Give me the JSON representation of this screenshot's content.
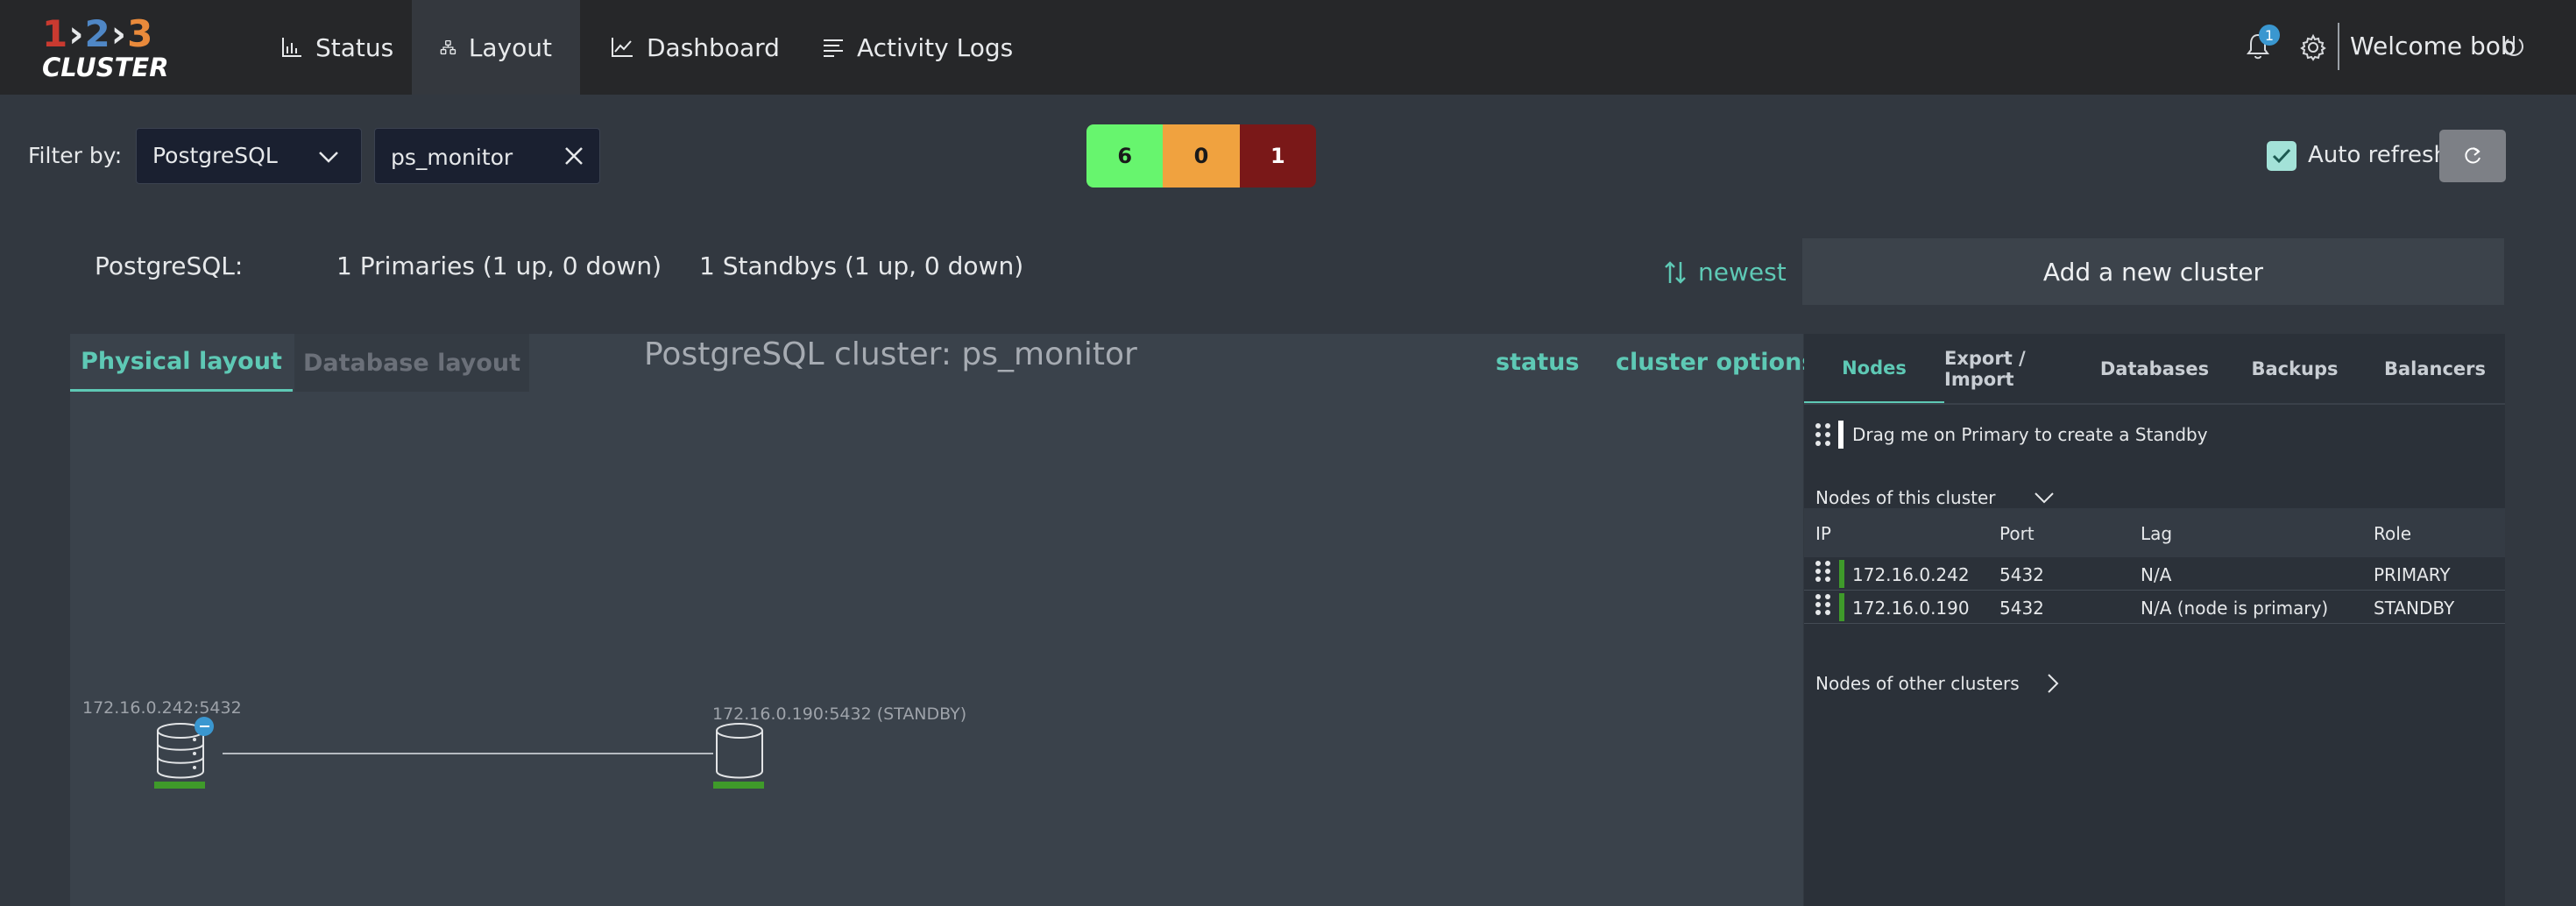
{
  "logo": {
    "n1": "1",
    "n2": "2",
    "n3": "3",
    "word": "CLUSTER"
  },
  "nav": {
    "items": [
      {
        "label": "Status",
        "icon": "bar-chart-icon"
      },
      {
        "label": "Layout",
        "icon": "topology-icon"
      },
      {
        "label": "Dashboard",
        "icon": "line-chart-icon"
      },
      {
        "label": "Activity Logs",
        "icon": "list-icon"
      }
    ],
    "active": "Layout"
  },
  "header": {
    "notification_count": "1",
    "welcome": "Welcome bob"
  },
  "filter": {
    "label": "Filter by:",
    "db_type": "PostgreSQL",
    "search_value": "ps_monitor"
  },
  "counts": {
    "up": "6",
    "warn": "0",
    "down": "1"
  },
  "auto_refresh": {
    "label": "Auto refresh",
    "checked": true
  },
  "summary": {
    "label": "PostgreSQL:",
    "primaries": "1 Primaries (1 up, 0 down)",
    "standbys": "1 Standbys (1 up, 0 down)",
    "sort": "newest"
  },
  "add_cluster": "Add a new cluster",
  "layout": {
    "tabs": [
      "Physical layout",
      "Database layout"
    ],
    "active_tab": "Physical layout",
    "cluster_title": "PostgreSQL cluster: ps_monitor",
    "links": {
      "status": "status",
      "options": "cluster options"
    },
    "nodes": [
      {
        "label": "172.16.0.242:5432"
      },
      {
        "label": "172.16.0.190:5432 (STANDBY)"
      }
    ]
  },
  "right_panel": {
    "tabs": [
      "Nodes",
      "Export / Import",
      "Databases",
      "Backups",
      "Balancers"
    ],
    "active_tab": "Nodes",
    "drag_hint": "Drag me on Primary to create a Standby",
    "nodes_this": "Nodes of this cluster",
    "columns": [
      "IP",
      "Port",
      "Lag",
      "Role"
    ],
    "rows": [
      {
        "ip": "172.16.0.242",
        "port": "5432",
        "lag": "N/A",
        "role": "PRIMARY"
      },
      {
        "ip": "172.16.0.190",
        "port": "5432",
        "lag": "N/A (node is primary)",
        "role": "STANDBY"
      }
    ],
    "nodes_other": "Nodes of other clusters"
  },
  "colors": {
    "accent": "#5ec9b5",
    "up": "#67f56e",
    "warn": "#f0a23f",
    "down": "#7a1818",
    "node_ok": "#3f9a2a",
    "badge": "#3a97d0"
  }
}
